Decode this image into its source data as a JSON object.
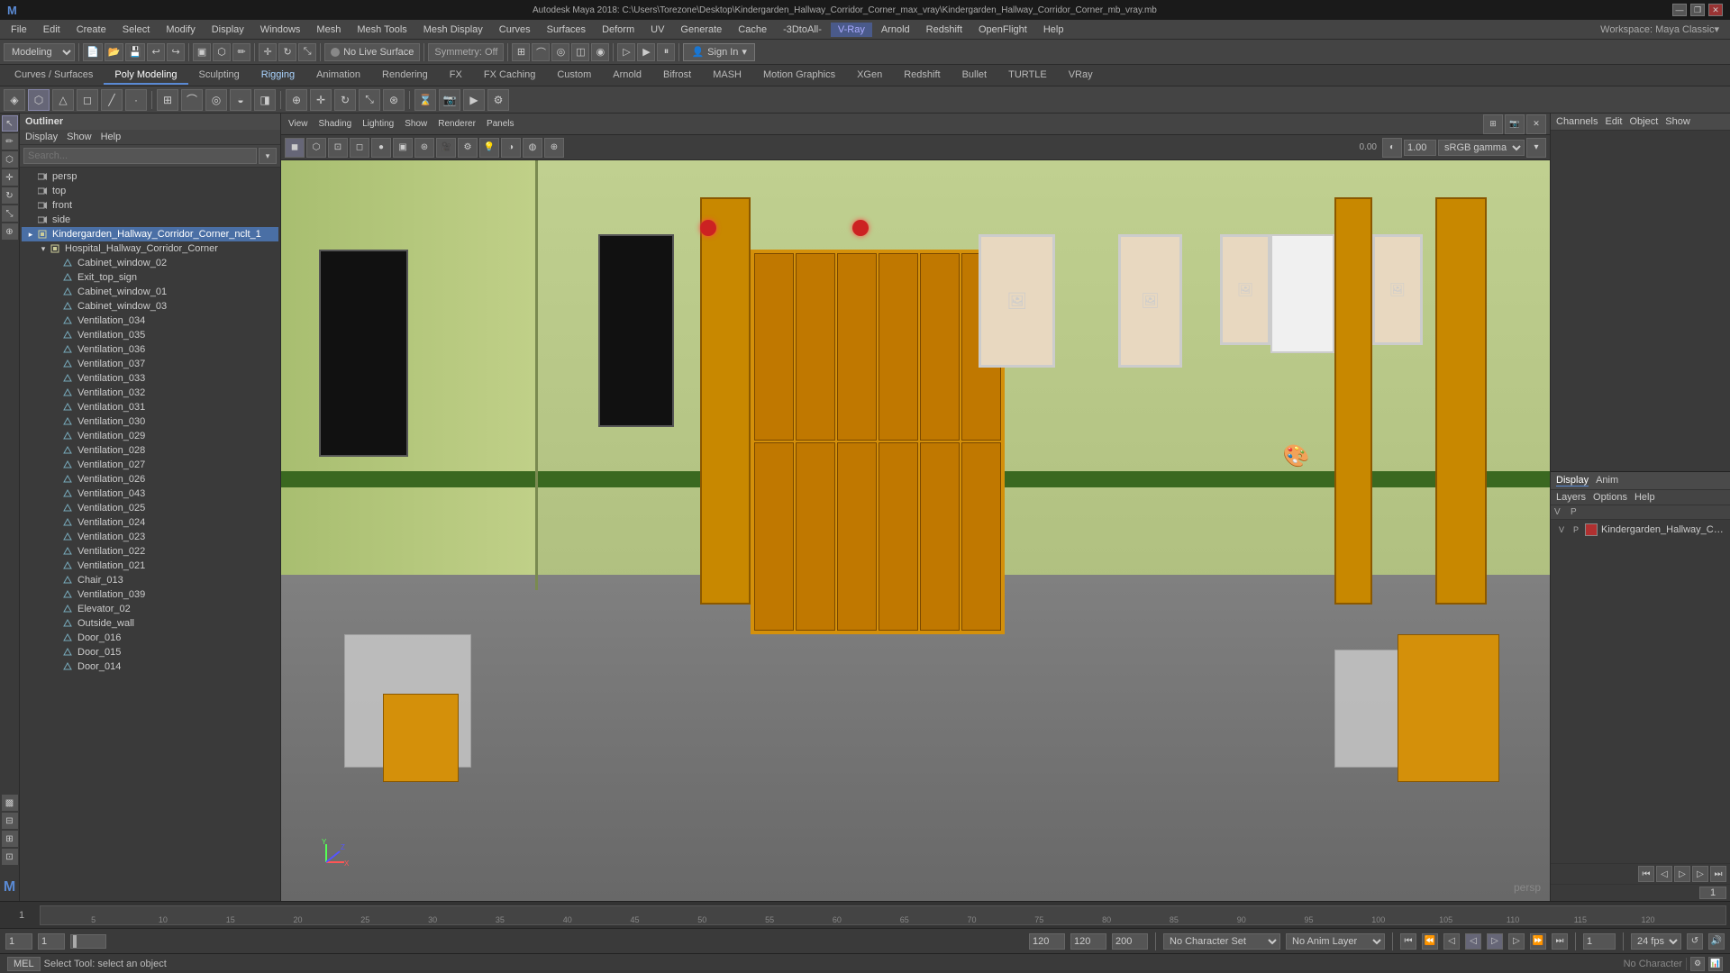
{
  "titlebar": {
    "title": "Autodesk Maya 2018: C:\\Users\\Torezone\\Desktop\\Kindergarden_Hallway_Corridor_Corner_max_vray\\Kindergarden_Hallway_Corridor_Corner_mb_vray.mb",
    "minimize": "—",
    "restore": "❐",
    "close": "✕"
  },
  "menubar": {
    "items": [
      "File",
      "Edit",
      "Create",
      "Select",
      "Modify",
      "Display",
      "Windows",
      "Mesh",
      "Mesh Tools",
      "Mesh Display",
      "Curves",
      "Surfaces",
      "Deform",
      "UV",
      "Generate",
      "Cache",
      "-3DtoAll-",
      "V-Ray",
      "Arnold",
      "Redshift",
      "OpenFlight",
      "Help"
    ]
  },
  "workspace": {
    "label": "Workspace: Maya Classic▾"
  },
  "toolbar1": {
    "mode_select": "Modeling",
    "no_live_surface": "No Live Surface",
    "symmetry": "Symmetry: Off",
    "sign_in": "Sign In"
  },
  "tabs": {
    "items": [
      "Curves / Surfaces",
      "Poly Modeling",
      "Sculpting",
      "Rigging",
      "Animation",
      "Rendering",
      "FX",
      "FX Caching",
      "Custom",
      "Arnold",
      "Bifrost",
      "MASH",
      "Motion Graphics",
      "XGen",
      "Redshift",
      "Bullet",
      "TURTLE",
      "VRay"
    ]
  },
  "outliner": {
    "title": "Outliner",
    "menu": [
      "Display",
      "Show",
      "Help"
    ],
    "search_placeholder": "Search...",
    "tree": [
      {
        "label": "persp",
        "type": "camera",
        "indent": 0
      },
      {
        "label": "top",
        "type": "camera",
        "indent": 0
      },
      {
        "label": "front",
        "type": "camera",
        "indent": 0
      },
      {
        "label": "side",
        "type": "camera",
        "indent": 0
      },
      {
        "label": "Kindergarden_Hallway_Corridor_Corner_nclt_1",
        "type": "group",
        "indent": 0,
        "selected": true
      },
      {
        "label": "Hospital_Hallway_Corridor_Corner",
        "type": "group",
        "indent": 1
      },
      {
        "label": "Cabinet_window_02",
        "type": "mesh",
        "indent": 2
      },
      {
        "label": "Exit_top_sign",
        "type": "mesh",
        "indent": 2
      },
      {
        "label": "Cabinet_window_01",
        "type": "mesh",
        "indent": 2
      },
      {
        "label": "Cabinet_window_03",
        "type": "mesh",
        "indent": 2
      },
      {
        "label": "Ventilation_034",
        "type": "mesh",
        "indent": 2
      },
      {
        "label": "Ventilation_035",
        "type": "mesh",
        "indent": 2
      },
      {
        "label": "Ventilation_036",
        "type": "mesh",
        "indent": 2
      },
      {
        "label": "Ventilation_037",
        "type": "mesh",
        "indent": 2
      },
      {
        "label": "Ventilation_033",
        "type": "mesh",
        "indent": 2
      },
      {
        "label": "Ventilation_032",
        "type": "mesh",
        "indent": 2
      },
      {
        "label": "Ventilation_031",
        "type": "mesh",
        "indent": 2
      },
      {
        "label": "Ventilation_030",
        "type": "mesh",
        "indent": 2
      },
      {
        "label": "Ventilation_029",
        "type": "mesh",
        "indent": 2
      },
      {
        "label": "Ventilation_028",
        "type": "mesh",
        "indent": 2
      },
      {
        "label": "Ventilation_027",
        "type": "mesh",
        "indent": 2
      },
      {
        "label": "Ventilation_026",
        "type": "mesh",
        "indent": 2
      },
      {
        "label": "Ventilation_043",
        "type": "mesh",
        "indent": 2
      },
      {
        "label": "Ventilation_025",
        "type": "mesh",
        "indent": 2
      },
      {
        "label": "Ventilation_024",
        "type": "mesh",
        "indent": 2
      },
      {
        "label": "Ventilation_023",
        "type": "mesh",
        "indent": 2
      },
      {
        "label": "Ventilation_022",
        "type": "mesh",
        "indent": 2
      },
      {
        "label": "Ventilation_021",
        "type": "mesh",
        "indent": 2
      },
      {
        "label": "Chair_013",
        "type": "mesh",
        "indent": 2
      },
      {
        "label": "Ventilation_039",
        "type": "mesh",
        "indent": 2
      },
      {
        "label": "Elevator_02",
        "type": "mesh",
        "indent": 2
      },
      {
        "label": "Outside_wall",
        "type": "mesh",
        "indent": 2
      },
      {
        "label": "Door_016",
        "type": "mesh",
        "indent": 2
      },
      {
        "label": "Door_015",
        "type": "mesh",
        "indent": 2
      },
      {
        "label": "Door_014",
        "type": "mesh",
        "indent": 2
      }
    ]
  },
  "viewport": {
    "menu": [
      "View",
      "Shading",
      "Lighting",
      "Show",
      "Renderer",
      "Panels"
    ],
    "camera_label": "persp",
    "gamma_label": "sRGB gamma",
    "gamma_value": "1.00",
    "value1": "0.00"
  },
  "channelbox": {
    "menu": [
      "Channels",
      "Edit",
      "Object",
      "Show"
    ]
  },
  "layers": {
    "tabs": [
      "Display",
      "Anim"
    ],
    "submenu": [
      "Layers",
      "Options",
      "Help"
    ],
    "columns": [
      "V",
      "P"
    ],
    "items": [
      {
        "v": "V",
        "p": "P",
        "color": "#b03030",
        "name": "Kindergarden_Hallway_Corridor_C"
      }
    ]
  },
  "timeline": {
    "start": "1",
    "end": "120",
    "current": "1",
    "range_start": "1",
    "range_end": "200",
    "fps": "24 fps",
    "ticks": [
      "5",
      "10",
      "15",
      "20",
      "25",
      "30",
      "35",
      "40",
      "45",
      "50",
      "55",
      "60",
      "65",
      "70",
      "75",
      "80",
      "85",
      "90",
      "95",
      "100",
      "105",
      "110",
      "115",
      "120"
    ]
  },
  "playback": {
    "frame_field": "1",
    "char_set": "No Character Set",
    "anim_layer": "No Anim Layer",
    "fps_select": "24 fps",
    "range_start": "1",
    "range_end": "120",
    "total_end": "200",
    "no_character": "No Character"
  },
  "statusbar": {
    "mel_label": "MEL",
    "status_msg": "Select Tool: select an object"
  }
}
